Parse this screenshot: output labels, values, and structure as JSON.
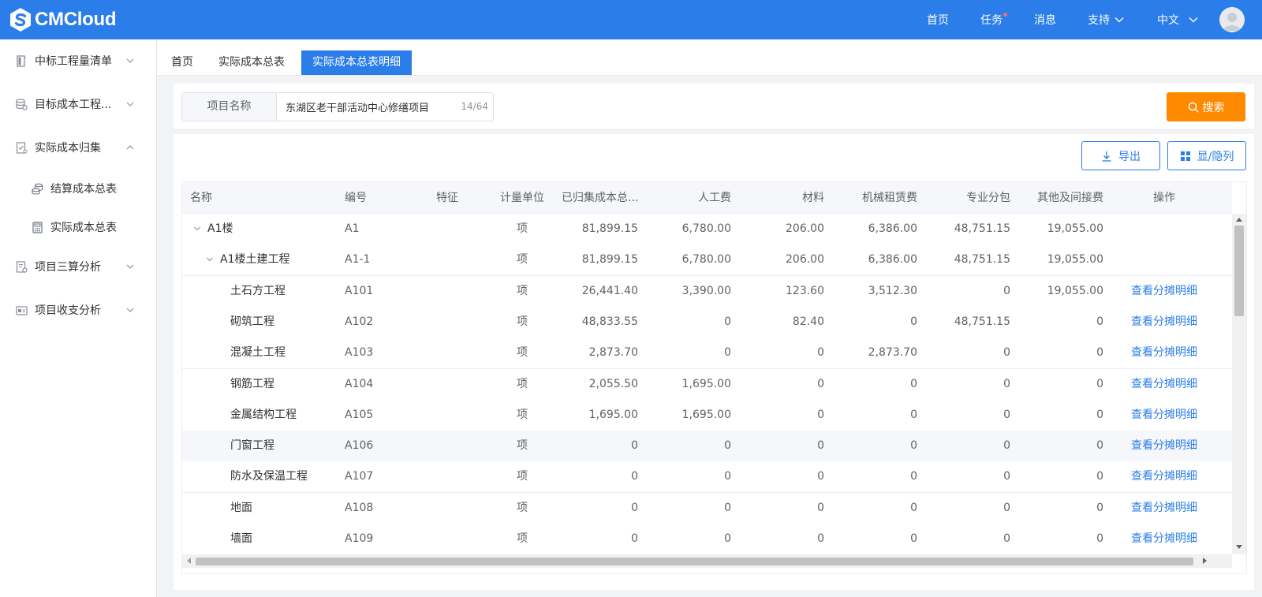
{
  "app": {
    "logo_text": "CMCloud",
    "brand_color": "#2b7de9",
    "accent_orange": "#ff8a00"
  },
  "topnav": {
    "home": "首页",
    "tasks": "任务",
    "messages": "消息",
    "support": "支持",
    "language": "中文"
  },
  "sidebar": {
    "items": [
      {
        "label": "中标工程量清单",
        "icon": "document-list-icon"
      },
      {
        "label": "目标成本工程...",
        "icon": "database-settings-icon"
      },
      {
        "label": "实际成本归集",
        "icon": "checklist-icon"
      },
      {
        "label": "结算成本总表",
        "icon": "coins-stack-icon"
      },
      {
        "label": "实际成本总表",
        "icon": "calculator-icon"
      },
      {
        "label": "项目三算分析",
        "icon": "document-analysis-icon"
      },
      {
        "label": "项目收支分析",
        "icon": "card-icon"
      }
    ]
  },
  "tabs": [
    {
      "label": "首页"
    },
    {
      "label": "实际成本总表"
    },
    {
      "label": "实际成本总表明细"
    }
  ],
  "search": {
    "field_label": "项目名称",
    "value": "东湖区老干部活动中心修缮项目",
    "count": "14/64",
    "button": "搜索"
  },
  "toolbar": {
    "export": "导出",
    "toggle_columns": "显/隐列"
  },
  "table": {
    "columns": [
      "名称",
      "编号",
      "特征",
      "计量单位",
      "已归集成本总...",
      "人工费",
      "材料",
      "机械租赁费",
      "专业分包",
      "其他及间接费",
      "操作"
    ],
    "rows": [
      {
        "name": "A1楼",
        "code": "A1",
        "feature": "",
        "unit": "项",
        "total": "81,899.15",
        "labor": "6,780.00",
        "material": "206.00",
        "machine": "6,386.00",
        "subcontract": "48,751.15",
        "other": "19,055.00",
        "action": ""
      },
      {
        "name": "A1楼土建工程",
        "code": "A1-1",
        "feature": "",
        "unit": "项",
        "total": "81,899.15",
        "labor": "6,780.00",
        "material": "206.00",
        "machine": "6,386.00",
        "subcontract": "48,751.15",
        "other": "19,055.00",
        "action": ""
      },
      {
        "name": "土石方工程",
        "code": "A101",
        "feature": "",
        "unit": "项",
        "total": "26,441.40",
        "labor": "3,390.00",
        "material": "123.60",
        "machine": "3,512.30",
        "subcontract": "0",
        "other": "19,055.00",
        "action": "查看分摊明细"
      },
      {
        "name": "砌筑工程",
        "code": "A102",
        "feature": "",
        "unit": "项",
        "total": "48,833.55",
        "labor": "0",
        "material": "82.40",
        "machine": "0",
        "subcontract": "48,751.15",
        "other": "0",
        "action": "查看分摊明细"
      },
      {
        "name": "混凝土工程",
        "code": "A103",
        "feature": "",
        "unit": "项",
        "total": "2,873.70",
        "labor": "0",
        "material": "0",
        "machine": "2,873.70",
        "subcontract": "0",
        "other": "0",
        "action": "查看分摊明细"
      },
      {
        "name": "钢筋工程",
        "code": "A104",
        "feature": "",
        "unit": "项",
        "total": "2,055.50",
        "labor": "1,695.00",
        "material": "0",
        "machine": "0",
        "subcontract": "0",
        "other": "0",
        "action": "查看分摊明细"
      },
      {
        "name": "金属结构工程",
        "code": "A105",
        "feature": "",
        "unit": "项",
        "total": "1,695.00",
        "labor": "1,695.00",
        "material": "0",
        "machine": "0",
        "subcontract": "0",
        "other": "0",
        "action": "查看分摊明细"
      },
      {
        "name": "门窗工程",
        "code": "A106",
        "feature": "",
        "unit": "项",
        "total": "0",
        "labor": "0",
        "material": "0",
        "machine": "0",
        "subcontract": "0",
        "other": "0",
        "action": "查看分摊明细"
      },
      {
        "name": "防水及保温工程",
        "code": "A107",
        "feature": "",
        "unit": "项",
        "total": "0",
        "labor": "0",
        "material": "0",
        "machine": "0",
        "subcontract": "0",
        "other": "0",
        "action": "查看分摊明细"
      },
      {
        "name": "地面",
        "code": "A108",
        "feature": "",
        "unit": "项",
        "total": "0",
        "labor": "0",
        "material": "0",
        "machine": "0",
        "subcontract": "0",
        "other": "0",
        "action": "查看分摊明细"
      },
      {
        "name": "墙面",
        "code": "A109",
        "feature": "",
        "unit": "项",
        "total": "0",
        "labor": "0",
        "material": "0",
        "machine": "0",
        "subcontract": "0",
        "other": "0",
        "action": "查看分摊明细"
      }
    ]
  }
}
